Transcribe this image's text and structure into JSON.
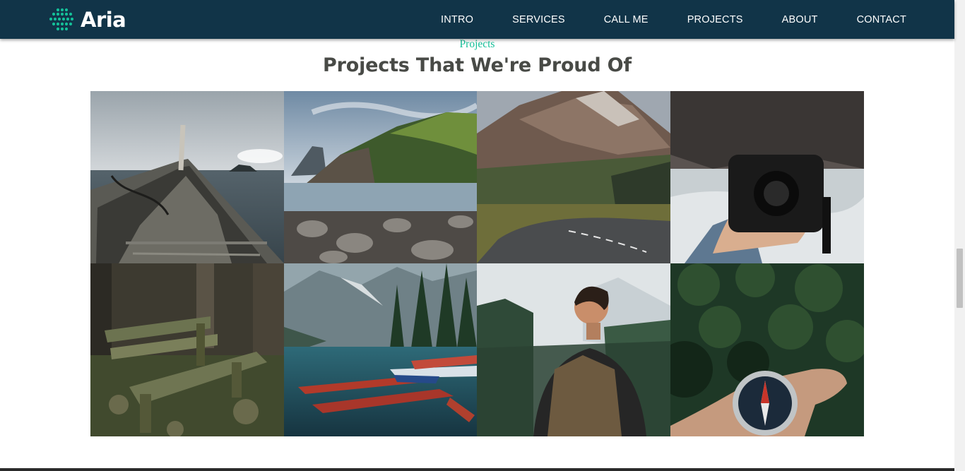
{
  "brand": {
    "name": "Aria",
    "accent_color": "#14bf98",
    "logo_icon": "dot-grid-logo-icon"
  },
  "nav": {
    "background": "#113448",
    "items": [
      {
        "label": "INTRO"
      },
      {
        "label": "SERVICES"
      },
      {
        "label": "CALL ME"
      },
      {
        "label": "PROJECTS"
      },
      {
        "label": "ABOUT"
      },
      {
        "label": "CONTACT"
      }
    ]
  },
  "projects": {
    "eyebrow": "Projects",
    "title": "Projects That We're Proud Of",
    "tiles": [
      {
        "subject": "wooden boat bow on the sea"
      },
      {
        "subject": "green sea cliff above a rocky shore"
      },
      {
        "subject": "mountain road winding through a valley"
      },
      {
        "subject": "hand holding a camera by a river"
      },
      {
        "subject": "mossy wooden bench in a forest"
      },
      {
        "subject": "canoes moored on a mountain lake"
      },
      {
        "subject": "hiker with backpack facing a forest"
      },
      {
        "subject": "hand holding a compass over a forest"
      }
    ]
  },
  "scrollbar": {
    "position_fraction": 0.58
  }
}
